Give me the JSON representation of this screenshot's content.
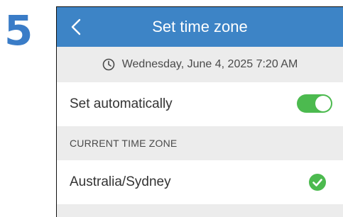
{
  "step": {
    "number": "5"
  },
  "header": {
    "title": "Set time zone",
    "back_icon": "chevron-left-icon"
  },
  "datetime": {
    "icon": "clock-icon",
    "text": "Wednesday, June 4, 2025 7:20 AM"
  },
  "auto": {
    "label": "Set automatically",
    "enabled": true
  },
  "section": {
    "label": "CURRENT TIME ZONE"
  },
  "timezone": {
    "value": "Australia/Sydney",
    "selected_icon": "check-circle-icon"
  },
  "colors": {
    "header": "#3d84c6",
    "step_number": "#3a7cc7",
    "toggle_on": "#4cba4f",
    "check": "#4cba4f",
    "background": "#ececec"
  }
}
